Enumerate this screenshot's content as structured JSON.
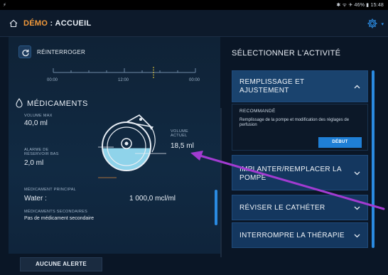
{
  "status_bar": {
    "left": "⚡",
    "right": "✱ ᯤ ✈ 46% ▮ 15:48"
  },
  "app_bar": {
    "title_prefix": "DÉMO",
    "title_separator": " : ",
    "title_main": "ACCUEIL"
  },
  "left_pane": {
    "requery_label": "RÉINTERROGER",
    "timeline": {
      "ticks": [
        "00:00",
        "12:00",
        "00:00"
      ]
    },
    "medications": {
      "title": "MÉDICAMENTS",
      "volume_max_label": "VOLUME MAX",
      "volume_max_value": "40,0 ml",
      "low_reservoir_label": "ALARME DE RÉSERVOIR BAS",
      "low_reservoir_value": "2,0 ml",
      "current_volume_label": "VOLUME ACTUEL",
      "current_volume_value": "18,5 ml",
      "current_volume_fraction": 0.4625,
      "main_med_label": "MÉDICAMENT PRINCIPAL",
      "main_med_name": "Water :",
      "main_med_concentration": "1 000,0 mcl/ml",
      "secondary_med_label": "MÉDICAMENTS SECONDAIRES",
      "secondary_med_value": "Pas de médicament secondaire"
    }
  },
  "footer": {
    "alert_button": "AUCUNE ALERTE"
  },
  "right_pane": {
    "title": "SÉLECTIONNER L'ACTIVITÉ",
    "activities": [
      {
        "label_line1": "REMPLISSAGE ET",
        "label_line2": "AJUSTEMENT",
        "expanded": true,
        "recommended_label": "RECOMMANDÉ",
        "description": "Remplissage de la pompe et modification des réglages de perfusion",
        "start_button": "DÉBUT"
      },
      {
        "label_line1": "IMPLANTER/REMPLACER LA",
        "label_line2": "POMPE",
        "expanded": false
      },
      {
        "label_line1": "RÉVISER LE CATHÉTER",
        "expanded": false
      },
      {
        "label_line1": "INTERROMPRE LA THÉRAPIE",
        "expanded": false
      }
    ]
  },
  "colors": {
    "accent": "#2a8ae0",
    "demo_orange": "#f2993a",
    "annotation_arrow": "#a23bd1",
    "reservoir_fill": "#8fd3ea",
    "threshold_line": "#e08a3a"
  }
}
